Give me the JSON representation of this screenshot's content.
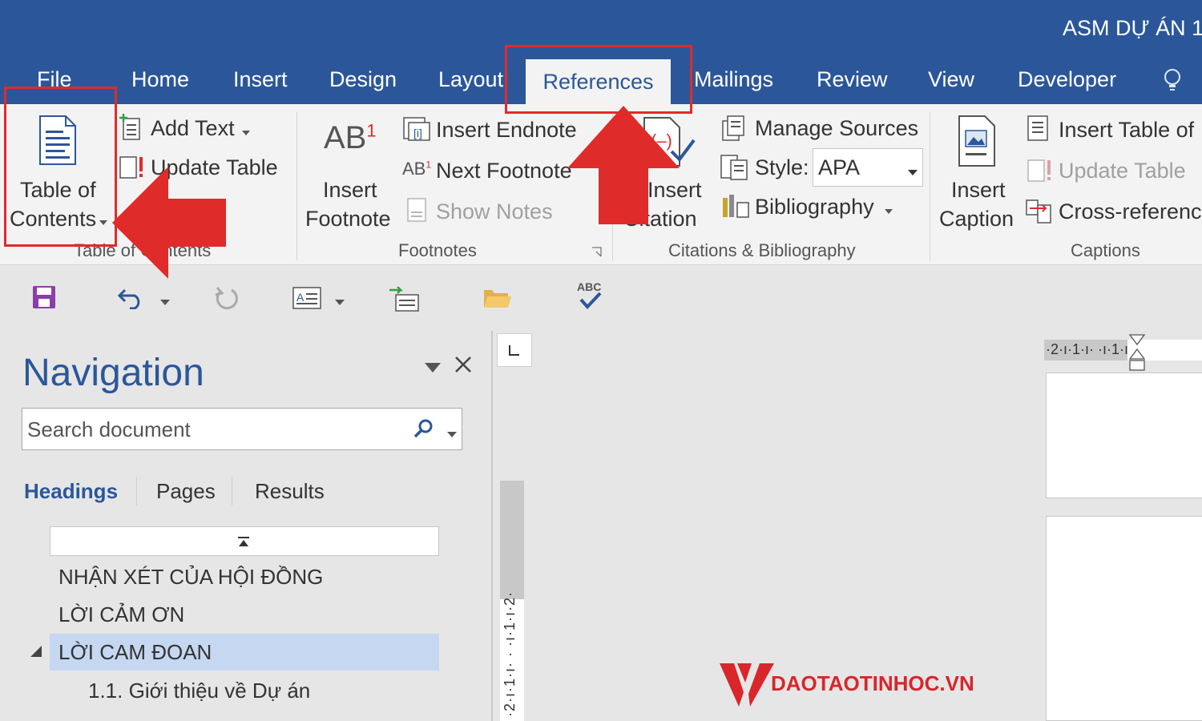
{
  "window": {
    "title": "ASM DỰ ÁN 1-"
  },
  "tabs": [
    "File",
    "Home",
    "Insert",
    "Design",
    "Layout",
    "References",
    "Mailings",
    "Review",
    "View",
    "Developer"
  ],
  "active_tab": "References",
  "ribbon": {
    "toc": {
      "button_label_line1": "Table of",
      "button_label_line2": "Contents",
      "add_text": "Add Text",
      "update_table": "Update Table",
      "group_label": "Table of Contents"
    },
    "footnotes": {
      "insert_footnote_line1": "Insert",
      "insert_footnote_line2": "Footnote",
      "insert_endnote": "Insert Endnote",
      "next_footnote": "Next Footnote",
      "show_notes": "Show Notes",
      "group_label": "Footnotes"
    },
    "citations": {
      "insert_citation_line1": "Insert",
      "insert_citation_line2": "Citation",
      "manage_sources": "Manage Sources",
      "style_label": "Style:",
      "style_value": "APA",
      "bibliography": "Bibliography",
      "group_label": "Citations & Bibliography"
    },
    "captions": {
      "insert_caption_line1": "Insert",
      "insert_caption_line2": "Caption",
      "insert_table_of_figures": "Insert Table of",
      "update_table": "Update Table",
      "cross_reference": "Cross-reference",
      "group_label": "Captions"
    }
  },
  "navigation": {
    "title": "Navigation",
    "search_placeholder": "Search document",
    "tabs": [
      "Headings",
      "Pages",
      "Results"
    ],
    "headings": [
      "NHẬN XÉT CỦA HỘI ĐỒNG",
      "LỜI CẢM ƠN",
      "LỜI CAM ĐOAN",
      "1.1. Giới thiệu về Dự án"
    ],
    "selected_heading": "LỜI CAM ĐOAN"
  },
  "rulers": {
    "horizontal": "·2·ı·1·ı·  ·ı·1·ı",
    "vertical": "·2·ı·1·ı· · ·ı·1·ı·2·"
  },
  "qat": {
    "spell_label": "ABC"
  },
  "watermark": {
    "text": "DAOTAOTINHOC.VN"
  },
  "colors": {
    "accent": "#2b579a",
    "annotation": "#e02b2b",
    "selection": "#c5d7f1"
  }
}
